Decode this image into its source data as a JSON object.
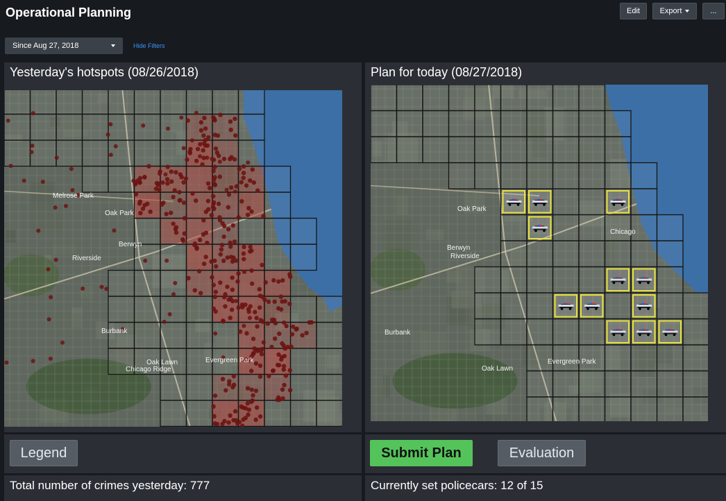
{
  "header": {
    "title": "Operational Planning",
    "edit_label": "Edit",
    "export_label": "Export",
    "more_label": "..."
  },
  "filters": {
    "time_range_value": "Since Aug 27, 2018",
    "hide_filters_label": "Hide Filters"
  },
  "left_panel": {
    "title": "Yesterday's hotspots (08/26/2018)",
    "legend_label": "Legend",
    "footer": "Total number of crimes yesterday: 777"
  },
  "right_panel": {
    "title": "Plan for today (08/27/2018)",
    "submit_label": "Submit Plan",
    "evaluation_label": "Evaluation",
    "footer": "Currently set policecars: 12 of 15"
  },
  "map_labels": {
    "left": [
      "Melrose Park",
      "Oak Park",
      "Berwyn",
      "Chicago Ridge",
      "Oak Lawn",
      "Burbank",
      "Evergreen Park",
      "Riverside"
    ],
    "right": [
      "Oak Park",
      "Berwyn",
      "Riverside",
      "Oak Lawn",
      "Evergreen Park",
      "Burbank",
      "Chicago"
    ]
  },
  "plan": {
    "assigned_cars": 12,
    "total_cars": 15
  },
  "colors": {
    "accent_blue": "#3a95ff",
    "submit_green": "#54c45a",
    "hotspot_red": "#b2403a",
    "crime_dot": "#6b1413",
    "car_cell_outline": "#e8e03c",
    "lake_blue": "#3c6fa5"
  },
  "icons": {
    "caret": "chevron-down-icon",
    "crime_marker": "crime-dot-icon",
    "police_car": "police-car-icon"
  }
}
